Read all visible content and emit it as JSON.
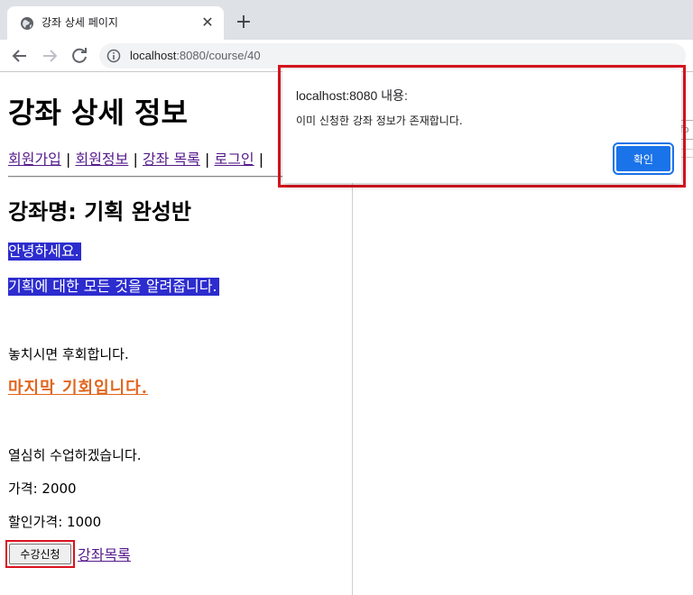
{
  "browser": {
    "tab_title": "강좌 상세 페이지",
    "new_tab_symbol": "+",
    "close_symbol": "✕",
    "url_host": "localhost",
    "url_path": ":8080/course/40"
  },
  "page": {
    "title": "강좌 상세 정보",
    "nav": {
      "signup": "회원가입",
      "member_info": "회원정보",
      "course_list": "강좌 목록",
      "login": "로그인",
      "separator": "|"
    },
    "course": {
      "name": "강좌명: 기획 완성반",
      "highlight_1": "안녕하세요.",
      "highlight_2": "기획에 대한 모든 것을 알려줍니다.",
      "miss_text": "놓치시면 후회합니다.",
      "last_chance": "마지막 기회입니다.",
      "study_text": "열심히 수업하겠습니다.",
      "price_text": "가격: 2000",
      "discount_text": "할인가격: 1000",
      "enroll_label": "수강신청",
      "course_list_link": "강좌목록"
    }
  },
  "alert": {
    "title": "localhost:8080 내용:",
    "message": "이미 신청한 강좌 정보가 존재합니다.",
    "ok_label": "확인"
  },
  "right_pane": {
    "field_fragment": "fo"
  },
  "colors": {
    "highlight_bg": "#2c2ccf",
    "accent_orange": "#e0661e",
    "link_visited": "#551a8b",
    "dialog_button": "#1a73e8",
    "annotation_red": "#d9141f"
  },
  "icons": {
    "favicon": "globe-icon",
    "back": "arrow-left-icon",
    "forward": "arrow-right-icon",
    "reload": "reload-icon",
    "site_info": "info-icon"
  }
}
